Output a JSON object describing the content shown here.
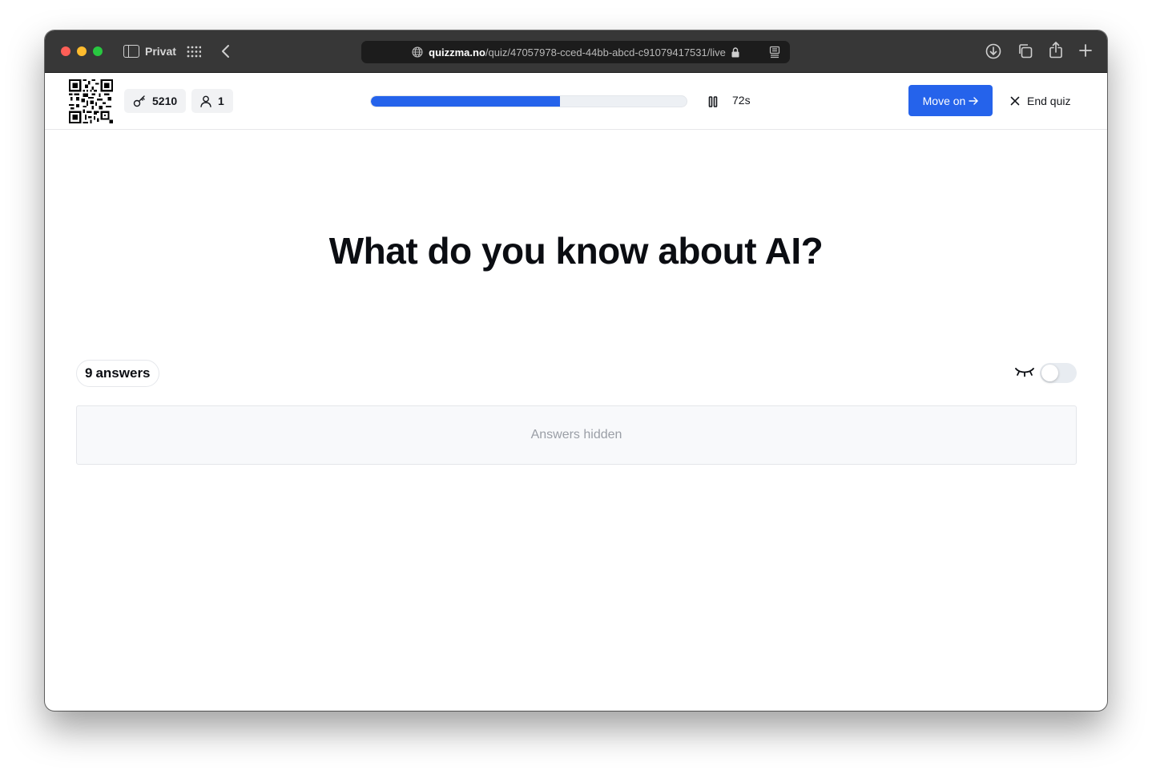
{
  "browser": {
    "profile_label": "Privat",
    "url_host": "quizzma.no",
    "url_path": "/quiz/47057978-cced-44bb-abcd-c91079417531/live",
    "icons": [
      "sidebar-icon",
      "grid-icon",
      "back-icon",
      "globe-icon",
      "lock-icon",
      "reader-icon",
      "download-icon",
      "tabs-icon",
      "share-icon",
      "new-tab-icon"
    ]
  },
  "header": {
    "game_code": "5210",
    "player_count": "1",
    "progress_fraction": 0.6,
    "timer": "72s",
    "move_on_label": "Move on",
    "end_quiz_label": "End quiz",
    "accent_color": "#2563eb"
  },
  "main": {
    "question": "What do you know about AI?",
    "answers_count": "9",
    "answers_label": "answers",
    "answers_hidden_text": "Answers hidden",
    "reveal_toggle_on": false
  }
}
